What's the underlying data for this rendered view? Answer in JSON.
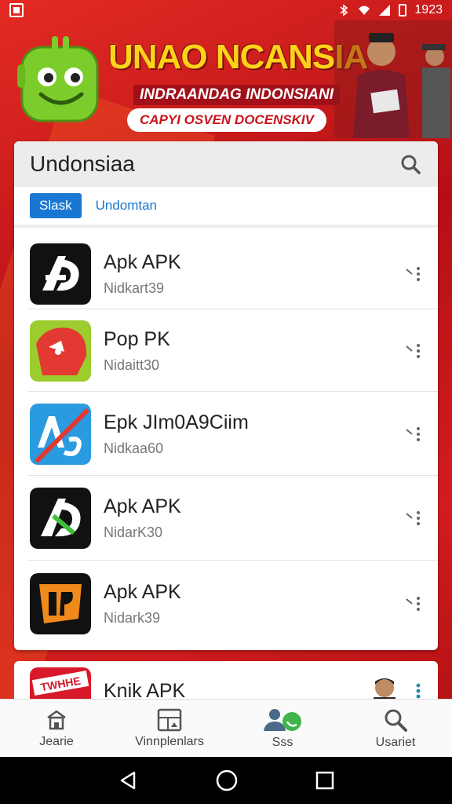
{
  "status_bar": {
    "time": "1923"
  },
  "banner": {
    "title": "UNAO NCANSIA",
    "subtitle": "INDRAANDAG INDONSIANI",
    "pill": "CAPYI OSVEN DOCENSKIV"
  },
  "card": {
    "title": "Undonsiaa",
    "tabs": [
      {
        "label": "Slask",
        "active": true
      },
      {
        "label": "Undomtan",
        "active": false
      }
    ],
    "items": [
      {
        "name": "Apk APK",
        "sub": "Nidkart39"
      },
      {
        "name": "Pop PK",
        "sub": "Nidaitt30"
      },
      {
        "name": "Epk JIm0A9Ciim",
        "sub": "Nidkaa60"
      },
      {
        "name": "Apk APK",
        "sub": "NidarK30"
      },
      {
        "name": "Apk APK",
        "sub": "Nidark39"
      }
    ]
  },
  "card2": {
    "item": {
      "name": "Knik APK",
      "icon_text": "TWHHE"
    }
  },
  "bottom_nav": [
    {
      "label": "Jearie",
      "icon": "home-icon"
    },
    {
      "label": "Vinnplenlars",
      "icon": "gallery-icon"
    },
    {
      "label": "Sss",
      "icon": "users-icon"
    },
    {
      "label": "Usariet",
      "icon": "search-icon"
    }
  ],
  "colors": {
    "accent": "#1877d2",
    "brand_red": "#c8141b",
    "title_yellow": "#ffd21a"
  }
}
